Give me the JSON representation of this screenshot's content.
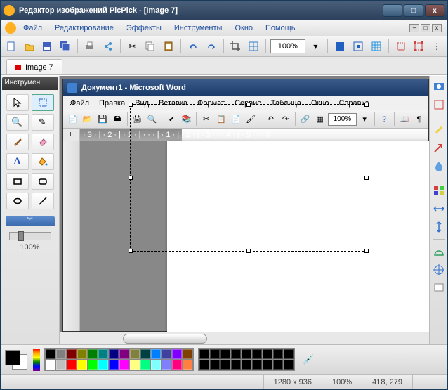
{
  "app": {
    "title": "Редактор изображений PicPick - [Image 7]"
  },
  "menu": {
    "file": "Файл",
    "edit": "Редактирование",
    "effects": "Эффекты",
    "tools": "Инструменты",
    "window": "Окно",
    "help": "Помощь"
  },
  "toolbar": {
    "zoom": "100%"
  },
  "tab": {
    "label": "Image 7"
  },
  "tool_panel": {
    "header": "Инструмен",
    "zoom_label": "100%"
  },
  "word": {
    "title": "Документ1 - Microsoft Word",
    "menu": {
      "file": "Файл",
      "edit": "Правка",
      "view": "Вид",
      "insert": "Вставка",
      "format": "Формат",
      "service": "Сервис",
      "table": "Таблица",
      "window": "Окно",
      "help": "Справка"
    },
    "zoom": "100%",
    "ruler_text": "· 3 · | · 2 · | · 1 · | · · · | · 1 · | · 2 · | · 3 · | · 4 · | · 5 · | · 6"
  },
  "status": {
    "dims": "1280 x 936",
    "zoom": "100%",
    "coords": "418, 279"
  },
  "palette": {
    "row1": [
      "#000",
      "#808080",
      "#800000",
      "#808000",
      "#008000",
      "#008080",
      "#000080",
      "#800080",
      "#808040",
      "#004040",
      "#0080ff",
      "#4040a0",
      "#8000ff",
      "#804000"
    ],
    "row2": [
      "#fff",
      "#c0c0c0",
      "#ff0000",
      "#ffff00",
      "#00ff00",
      "#00ffff",
      "#0000ff",
      "#ff00ff",
      "#ffff80",
      "#00ff80",
      "#80ffff",
      "#8080ff",
      "#ff0080",
      "#ff8040"
    ]
  }
}
